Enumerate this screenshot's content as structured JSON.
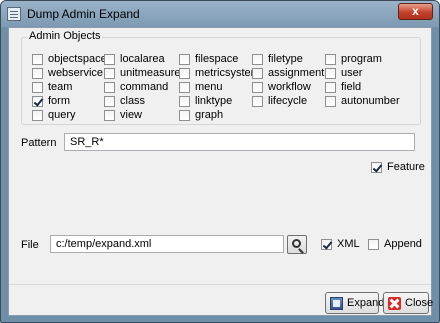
{
  "window": {
    "title": "Dump Admin Expand",
    "close_glyph": "x"
  },
  "admin_objects": {
    "title": "Admin Objects",
    "items": [
      {
        "label": "objectspace",
        "checked": false
      },
      {
        "label": "localarea",
        "checked": false
      },
      {
        "label": "filespace",
        "checked": false
      },
      {
        "label": "filetype",
        "checked": false
      },
      {
        "label": "program",
        "checked": false
      },
      {
        "label": "webservice",
        "checked": false
      },
      {
        "label": "unitmeasure",
        "checked": false
      },
      {
        "label": "metricsystem",
        "checked": false
      },
      {
        "label": "assignment",
        "checked": false
      },
      {
        "label": "user",
        "checked": false
      },
      {
        "label": "team",
        "checked": false
      },
      {
        "label": "command",
        "checked": false
      },
      {
        "label": "menu",
        "checked": false
      },
      {
        "label": "workflow",
        "checked": false
      },
      {
        "label": "field",
        "checked": false
      },
      {
        "label": "form",
        "checked": true
      },
      {
        "label": "class",
        "checked": false
      },
      {
        "label": "linktype",
        "checked": false
      },
      {
        "label": "lifecycle",
        "checked": false
      },
      {
        "label": "autonumber",
        "checked": false
      },
      {
        "label": "query",
        "checked": false
      },
      {
        "label": "view",
        "checked": false
      },
      {
        "label": "graph",
        "checked": false
      }
    ]
  },
  "pattern": {
    "label": "Pattern",
    "value": "SR_R*"
  },
  "feature": {
    "label": "Feature",
    "checked": true
  },
  "file": {
    "label": "File",
    "value": "c:/temp/expand.xml"
  },
  "xml": {
    "label": "XML",
    "checked": true
  },
  "append": {
    "label": "Append",
    "checked": false
  },
  "buttons": {
    "expand": "Expand",
    "close": "Close"
  }
}
